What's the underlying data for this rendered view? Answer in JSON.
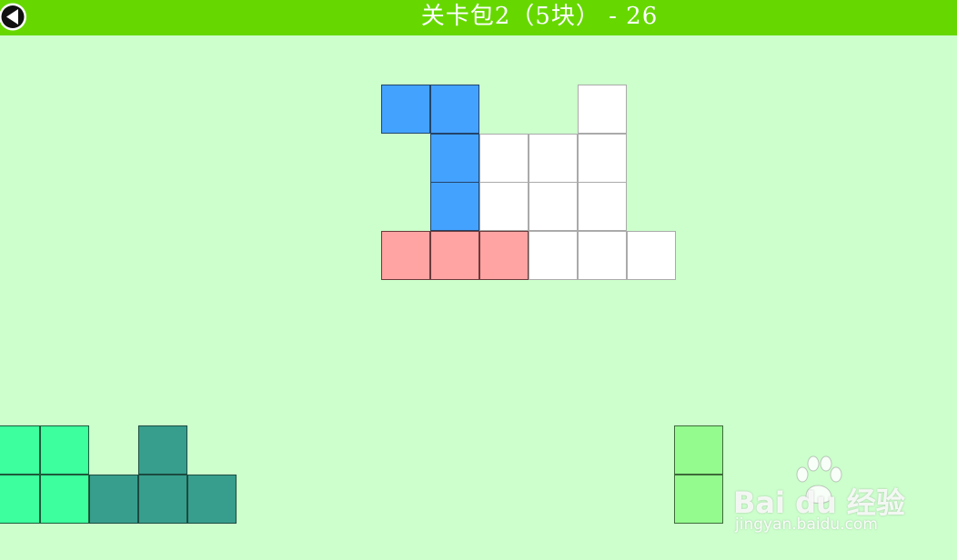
{
  "header": {
    "title": "关卡包2（5块） - 26",
    "back_icon": "back-arrow-icon"
  },
  "colors": {
    "background": "#ccffcc",
    "header": "#66d800",
    "board_cell": "#ffffff",
    "blue_piece": "#44a2ff",
    "pink_piece": "#ffa3a3",
    "mint_piece": "#3dff9e",
    "teal_piece": "#379e8d",
    "lime_piece": "#94fc8f"
  },
  "watermark": {
    "brand": "Bai du 经验",
    "url": "jingyan.baidu.com"
  }
}
